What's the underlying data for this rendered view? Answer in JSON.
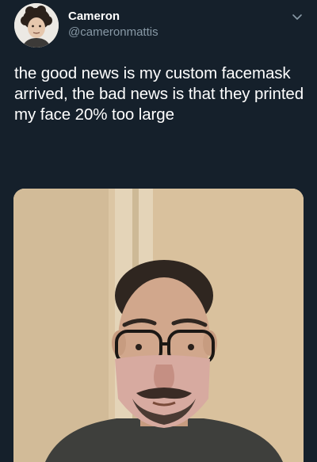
{
  "author": {
    "display_name": "Cameron",
    "handle": "@cameronmattis"
  },
  "tweet": {
    "text": "the good news is my custom facemask arrived, the bad news is that they printed my face 20% too large"
  },
  "icons": {
    "options": "chevron-down-icon"
  },
  "colors": {
    "background": "#15202b",
    "primary_text": "#ffffff",
    "secondary_text": "#8899a6"
  }
}
